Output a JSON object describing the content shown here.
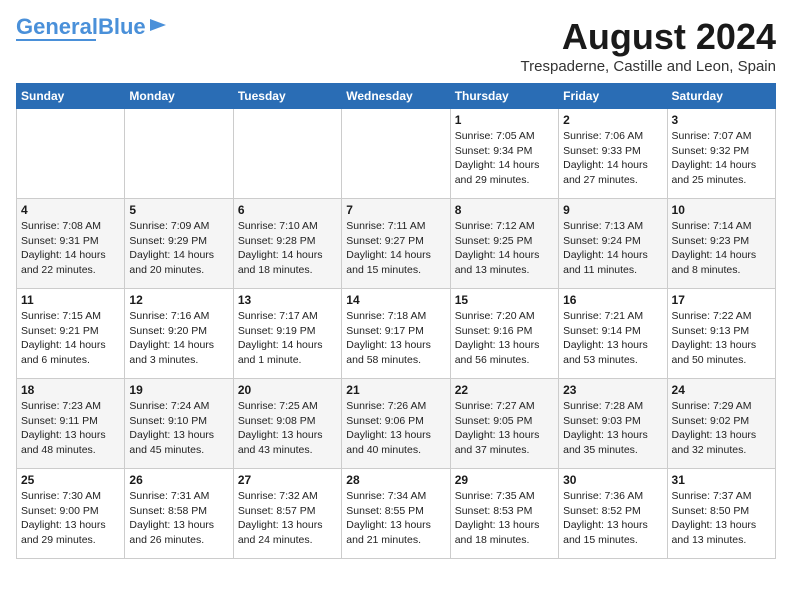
{
  "header": {
    "logo_general": "General",
    "logo_blue": "Blue",
    "month_year": "August 2024",
    "location": "Trespaderne, Castille and Leon, Spain"
  },
  "days_of_week": [
    "Sunday",
    "Monday",
    "Tuesday",
    "Wednesday",
    "Thursday",
    "Friday",
    "Saturday"
  ],
  "weeks": [
    [
      {
        "day": "",
        "info": ""
      },
      {
        "day": "",
        "info": ""
      },
      {
        "day": "",
        "info": ""
      },
      {
        "day": "",
        "info": ""
      },
      {
        "day": "1",
        "info": "Sunrise: 7:05 AM\nSunset: 9:34 PM\nDaylight: 14 hours and 29 minutes."
      },
      {
        "day": "2",
        "info": "Sunrise: 7:06 AM\nSunset: 9:33 PM\nDaylight: 14 hours and 27 minutes."
      },
      {
        "day": "3",
        "info": "Sunrise: 7:07 AM\nSunset: 9:32 PM\nDaylight: 14 hours and 25 minutes."
      }
    ],
    [
      {
        "day": "4",
        "info": "Sunrise: 7:08 AM\nSunset: 9:31 PM\nDaylight: 14 hours and 22 minutes."
      },
      {
        "day": "5",
        "info": "Sunrise: 7:09 AM\nSunset: 9:29 PM\nDaylight: 14 hours and 20 minutes."
      },
      {
        "day": "6",
        "info": "Sunrise: 7:10 AM\nSunset: 9:28 PM\nDaylight: 14 hours and 18 minutes."
      },
      {
        "day": "7",
        "info": "Sunrise: 7:11 AM\nSunset: 9:27 PM\nDaylight: 14 hours and 15 minutes."
      },
      {
        "day": "8",
        "info": "Sunrise: 7:12 AM\nSunset: 9:25 PM\nDaylight: 14 hours and 13 minutes."
      },
      {
        "day": "9",
        "info": "Sunrise: 7:13 AM\nSunset: 9:24 PM\nDaylight: 14 hours and 11 minutes."
      },
      {
        "day": "10",
        "info": "Sunrise: 7:14 AM\nSunset: 9:23 PM\nDaylight: 14 hours and 8 minutes."
      }
    ],
    [
      {
        "day": "11",
        "info": "Sunrise: 7:15 AM\nSunset: 9:21 PM\nDaylight: 14 hours and 6 minutes."
      },
      {
        "day": "12",
        "info": "Sunrise: 7:16 AM\nSunset: 9:20 PM\nDaylight: 14 hours and 3 minutes."
      },
      {
        "day": "13",
        "info": "Sunrise: 7:17 AM\nSunset: 9:19 PM\nDaylight: 14 hours and 1 minute."
      },
      {
        "day": "14",
        "info": "Sunrise: 7:18 AM\nSunset: 9:17 PM\nDaylight: 13 hours and 58 minutes."
      },
      {
        "day": "15",
        "info": "Sunrise: 7:20 AM\nSunset: 9:16 PM\nDaylight: 13 hours and 56 minutes."
      },
      {
        "day": "16",
        "info": "Sunrise: 7:21 AM\nSunset: 9:14 PM\nDaylight: 13 hours and 53 minutes."
      },
      {
        "day": "17",
        "info": "Sunrise: 7:22 AM\nSunset: 9:13 PM\nDaylight: 13 hours and 50 minutes."
      }
    ],
    [
      {
        "day": "18",
        "info": "Sunrise: 7:23 AM\nSunset: 9:11 PM\nDaylight: 13 hours and 48 minutes."
      },
      {
        "day": "19",
        "info": "Sunrise: 7:24 AM\nSunset: 9:10 PM\nDaylight: 13 hours and 45 minutes."
      },
      {
        "day": "20",
        "info": "Sunrise: 7:25 AM\nSunset: 9:08 PM\nDaylight: 13 hours and 43 minutes."
      },
      {
        "day": "21",
        "info": "Sunrise: 7:26 AM\nSunset: 9:06 PM\nDaylight: 13 hours and 40 minutes."
      },
      {
        "day": "22",
        "info": "Sunrise: 7:27 AM\nSunset: 9:05 PM\nDaylight: 13 hours and 37 minutes."
      },
      {
        "day": "23",
        "info": "Sunrise: 7:28 AM\nSunset: 9:03 PM\nDaylight: 13 hours and 35 minutes."
      },
      {
        "day": "24",
        "info": "Sunrise: 7:29 AM\nSunset: 9:02 PM\nDaylight: 13 hours and 32 minutes."
      }
    ],
    [
      {
        "day": "25",
        "info": "Sunrise: 7:30 AM\nSunset: 9:00 PM\nDaylight: 13 hours and 29 minutes."
      },
      {
        "day": "26",
        "info": "Sunrise: 7:31 AM\nSunset: 8:58 PM\nDaylight: 13 hours and 26 minutes."
      },
      {
        "day": "27",
        "info": "Sunrise: 7:32 AM\nSunset: 8:57 PM\nDaylight: 13 hours and 24 minutes."
      },
      {
        "day": "28",
        "info": "Sunrise: 7:34 AM\nSunset: 8:55 PM\nDaylight: 13 hours and 21 minutes."
      },
      {
        "day": "29",
        "info": "Sunrise: 7:35 AM\nSunset: 8:53 PM\nDaylight: 13 hours and 18 minutes."
      },
      {
        "day": "30",
        "info": "Sunrise: 7:36 AM\nSunset: 8:52 PM\nDaylight: 13 hours and 15 minutes."
      },
      {
        "day": "31",
        "info": "Sunrise: 7:37 AM\nSunset: 8:50 PM\nDaylight: 13 hours and 13 minutes."
      }
    ]
  ]
}
